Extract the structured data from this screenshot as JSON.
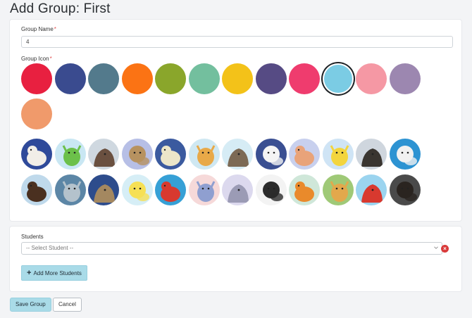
{
  "page": {
    "title": "Add Group: First"
  },
  "group_name": {
    "label": "Group Name",
    "required_mark": "*",
    "value": "4"
  },
  "group_icon": {
    "label": "Group Icon",
    "required_mark": "*",
    "colors": [
      {
        "name": "red",
        "hex": "#e82040"
      },
      {
        "name": "navy",
        "hex": "#3a4b8f"
      },
      {
        "name": "slate-teal",
        "hex": "#537a8c"
      },
      {
        "name": "orange",
        "hex": "#fb7314"
      },
      {
        "name": "olive-green",
        "hex": "#8aa62b"
      },
      {
        "name": "mint",
        "hex": "#73bf9e"
      },
      {
        "name": "yellow",
        "hex": "#f3c219"
      },
      {
        "name": "indigo",
        "hex": "#564b84"
      },
      {
        "name": "pink",
        "hex": "#ef3c6e"
      },
      {
        "name": "sky-blue",
        "hex": "#7bcce4",
        "selected": true
      },
      {
        "name": "light-pink",
        "hex": "#f598a4"
      },
      {
        "name": "lavender",
        "hex": "#9c87b0"
      },
      {
        "name": "peach",
        "hex": "#f09a6b"
      }
    ],
    "images": [
      {
        "name": "puppy-sweater",
        "bg": "#2f4a9a",
        "fg": "#f1eee8"
      },
      {
        "name": "green-dragon",
        "bg": "#c9e7f3",
        "fg": "#6cc04a"
      },
      {
        "name": "knit-hat-dog",
        "bg": "#cfd8e0",
        "fg": "#6a5040"
      },
      {
        "name": "yorkie-flowers",
        "bg": "#b7bfe6",
        "fg": "#b79260"
      },
      {
        "name": "cartoon-duck",
        "bg": "#3b5a9f",
        "fg": "#ece6c9"
      },
      {
        "name": "giraffe",
        "bg": "#cfe8f2",
        "fg": "#e8a948"
      },
      {
        "name": "yorkie",
        "bg": "#d6ecf5",
        "fg": "#7c6a55"
      },
      {
        "name": "zebra",
        "bg": "#3a4f92",
        "fg": "#f4f4f4"
      },
      {
        "name": "kangaroo",
        "bg": "#c8d0ee",
        "fg": "#e9a37a"
      },
      {
        "name": "toy-horse",
        "bg": "#cfe4f5",
        "fg": "#f3d53e"
      },
      {
        "name": "pug",
        "bg": "#cfd6de",
        "fg": "#3a3530"
      },
      {
        "name": "white-cat",
        "bg": "#2d93d2",
        "fg": "#f1f1f1"
      },
      {
        "name": "spaniel",
        "bg": "#bfd9eb",
        "fg": "#4a3020"
      },
      {
        "name": "grey-dog",
        "bg": "#5c86a6",
        "fg": "#b4c2cc"
      },
      {
        "name": "terrier",
        "bg": "#2d4c8c",
        "fg": "#a48860"
      },
      {
        "name": "yellow-duck",
        "bg": "#d6eef6",
        "fg": "#f6e055"
      },
      {
        "name": "dog-red-hat",
        "bg": "#36a0d6",
        "fg": "#d8392f"
      },
      {
        "name": "toy-robots",
        "bg": "#f6d9d9",
        "fg": "#8f9fd0"
      },
      {
        "name": "robot-toy",
        "bg": "#dcd9ee",
        "fg": "#9b9bb5"
      },
      {
        "name": "cartoon-cow",
        "bg": "#f3f3f3",
        "fg": "#2b2b2b"
      },
      {
        "name": "orange-lion",
        "bg": "#cfe7d9",
        "fg": "#e98a2b"
      },
      {
        "name": "toy-animals",
        "bg": "#9fc977",
        "fg": "#e2a84c"
      },
      {
        "name": "rooster",
        "bg": "#9bd4ef",
        "fg": "#d8392f"
      },
      {
        "name": "black-dog",
        "bg": "#4a4a4a",
        "fg": "#2a2420"
      }
    ]
  },
  "students": {
    "label": "Students",
    "select_placeholder": "-- Select Student --",
    "remove_symbol": "×",
    "add_more_label": "Add More Students",
    "add_more_symbol": "+"
  },
  "actions": {
    "save_label": "Save Group",
    "cancel_label": "Cancel"
  }
}
